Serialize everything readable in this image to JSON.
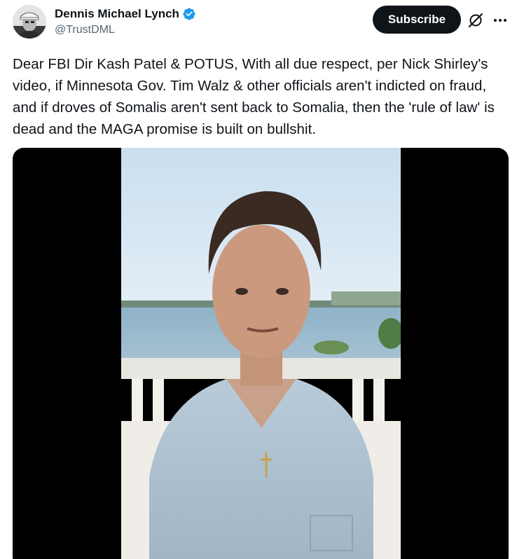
{
  "author": {
    "display_name": "Dennis Michael Lynch",
    "handle": "@TrustDML",
    "verified": true,
    "verified_color": "#1d9bf0"
  },
  "actions": {
    "subscribe_label": "Subscribe",
    "grok_icon": "grok-icon",
    "more_icon": "more-icon"
  },
  "tweet": {
    "text": "Dear FBI Dir Kash Patel & POTUS, With all due respect, per Nick Shirley's video, if Minnesota Gov. Tim Walz & other officials aren't indicted on fraud, and if droves of Somalis aren't sent back to Somalia, then the 'rule of law' is dead and the MAGA promise is built on bullshit."
  },
  "media": {
    "type": "video"
  },
  "colors": {
    "text": "#0f1419",
    "secondary_text": "#536471",
    "button_bg": "#0f1419",
    "button_text": "#ffffff"
  }
}
